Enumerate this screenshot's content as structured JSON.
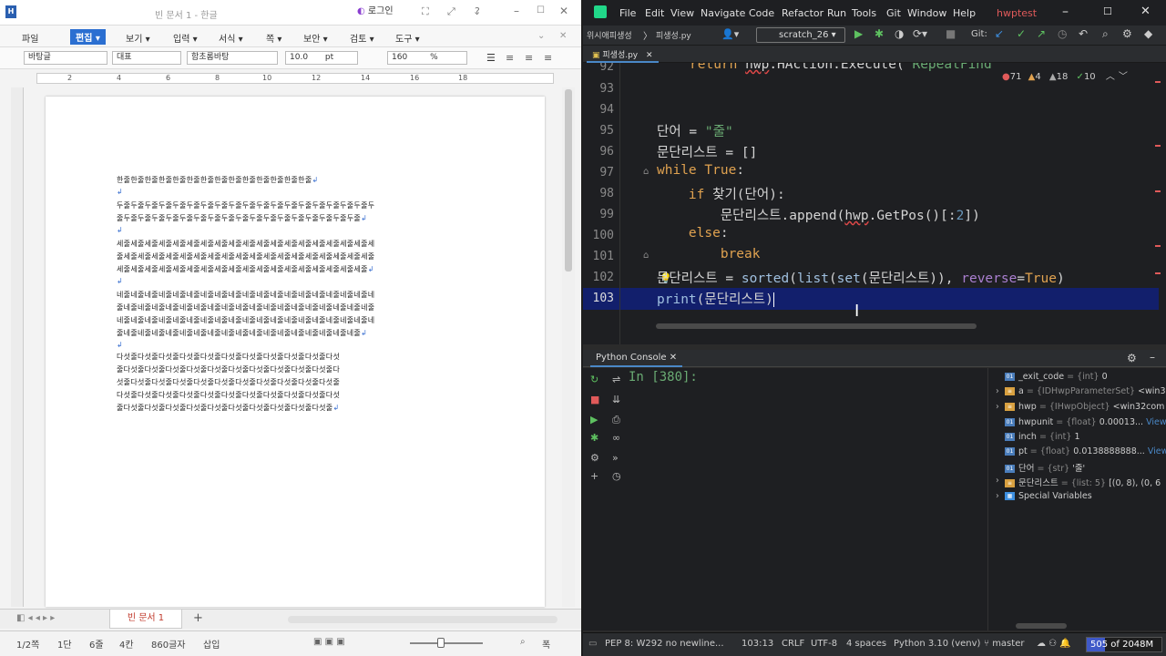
{
  "hwp": {
    "title": "빈 문서 1 - 한글",
    "login": "로그인",
    "menu": [
      "파일",
      "편집",
      "보기",
      "입력",
      "서식",
      "쪽",
      "보안",
      "검토",
      "도구"
    ],
    "format": {
      "style": "바탕글",
      "lang": "대표",
      "font": "함초롬바탕",
      "size": "10.0",
      "size_unit": "pt",
      "zoom": "160",
      "zoom_unit": "%"
    },
    "ruler_marks": [
      "2",
      "4",
      "6",
      "8",
      "10",
      "12",
      "14",
      "16",
      "18"
    ],
    "doc_lines": [
      "한줄한줄한줄한줄한줄한줄한줄한줄한줄한줄한줄한줄한줄한줄",
      "두줄두줄두줄두줄두줄두줄두줄두줄두줄두줄두줄두줄두줄두줄두줄두줄두줄두줄두",
      "줄두줄두줄두줄두줄두줄두줄두줄두줄두줄두줄두줄두줄두줄두줄두줄두줄두줄",
      "세줄세줄세줄세줄세줄세줄세줄세줄세줄세줄세줄세줄세줄세줄세줄세줄세줄세줄세",
      "줄세줄세줄세줄세줄세줄세줄세줄세줄세줄세줄세줄세줄세줄세줄세줄세줄세줄세줄",
      "세줄세줄세줄세줄세줄세줄세줄세줄세줄세줄세줄세줄세줄세줄세줄세줄세줄세줄",
      "네줄네줄네줄네줄네줄네줄네줄네줄네줄네줄네줄네줄네줄네줄네줄네줄네줄네줄네",
      "줄네줄네줄네줄네줄네줄네줄네줄네줄네줄네줄네줄네줄네줄네줄네줄네줄네줄네줄",
      "네줄네줄네줄네줄네줄네줄네줄네줄네줄네줄네줄네줄네줄네줄네줄네줄네줄네줄네",
      "줄네줄네줄네줄네줄네줄네줄네줄네줄네줄네줄네줄네줄네줄네줄네줄네줄네줄",
      "다섯줄다섯줄다섯줄다섯줄다섯줄다섯줄다섯줄다섯줄다섯줄다섯줄다섯",
      "줄다섯줄다섯줄다섯줄다섯줄다섯줄다섯줄다섯줄다섯줄다섯줄다섯줄다",
      "섯줄다섯줄다섯줄다섯줄다섯줄다섯줄다섯줄다섯줄다섯줄다섯줄다섯줄",
      "다섯줄다섯줄다섯줄다섯줄다섯줄다섯줄다섯줄다섯줄다섯줄다섯줄다섯",
      "줄다섯줄다섯줄다섯줄다섯줄다섯줄다섯줄다섯줄다섯줄다섯줄다섯줄"
    ],
    "sheet_tab": "빈 문서 1",
    "status": {
      "page": "1/2쪽",
      "section": "1단",
      "line": "6줄",
      "col": "4칸",
      "chars": "860글자",
      "mode": "삽입",
      "zoom": "폭"
    }
  },
  "ide": {
    "menu": [
      "File",
      "Edit",
      "View",
      "Navigate",
      "Code",
      "Refactor",
      "Run",
      "Tools",
      "Git",
      "Window",
      "Help"
    ],
    "project": "hwptest",
    "breadcrumb": "위시애피생성",
    "file_crumb": "피생성.py",
    "run_config": "scratch_26",
    "git_label": "Git:",
    "tab_name": "피생성.py",
    "inspections": {
      "errors": "71",
      "warnings": "4",
      "weak": "18",
      "ok": "10"
    },
    "code_lines": [
      {
        "n": "92",
        "text": "    return hwp.HAction.Execute(\"RepeatFind\""
      },
      {
        "n": "93",
        "text": ""
      },
      {
        "n": "94",
        "text": ""
      },
      {
        "n": "95",
        "text": "단어 = \"줄\""
      },
      {
        "n": "96",
        "text": "문단리스트 = []"
      },
      {
        "n": "97",
        "text": "while True:"
      },
      {
        "n": "98",
        "text": "    if 찾기(단어):"
      },
      {
        "n": "99",
        "text": "        문단리스트.append(hwp.GetPos()[:2])"
      },
      {
        "n": "100",
        "text": "    else:"
      },
      {
        "n": "101",
        "text": "        break"
      },
      {
        "n": "102",
        "text": "문단리스트 = sorted(list(set(문단리스트)), reverse=True)"
      },
      {
        "n": "103",
        "text": "print(문단리스트)"
      }
    ],
    "console_tab": "Python Console",
    "prompt": "In [380]:",
    "variables": [
      {
        "name": "_exit_code",
        "type": "{int}",
        "value": "0",
        "badge": "01"
      },
      {
        "name": "a",
        "type": "{IDHwpParameterSet}",
        "value": "<win3",
        "badge": "≡"
      },
      {
        "name": "hwp",
        "type": "{IHwpObject}",
        "value": "<win32com",
        "badge": "≡"
      },
      {
        "name": "hwpunit",
        "type": "{float}",
        "value": "0.00013...",
        "badge": "01",
        "link": "View"
      },
      {
        "name": "inch",
        "type": "{int}",
        "value": "1",
        "badge": "01"
      },
      {
        "name": "pt",
        "type": "{float}",
        "value": "0.0138888888...",
        "badge": "01",
        "link": "View"
      },
      {
        "name": "단어",
        "type": "{str}",
        "value": "'줄'",
        "badge": "01"
      },
      {
        "name": "문단리스트",
        "type": "{list: 5}",
        "value": "[(0, 8), (0, 6",
        "badge": "≡"
      },
      {
        "name": "Special Variables",
        "type": "",
        "value": "",
        "badge": "▦"
      }
    ],
    "status": {
      "pep": "PEP 8: W292 no newline...",
      "pos": "103:13",
      "eol": "CRLF",
      "enc": "UTF-8",
      "indent": "4 spaces",
      "interp": "Python 3.10 (venv)",
      "branch": "master",
      "mem": "505 of 2048M"
    }
  }
}
